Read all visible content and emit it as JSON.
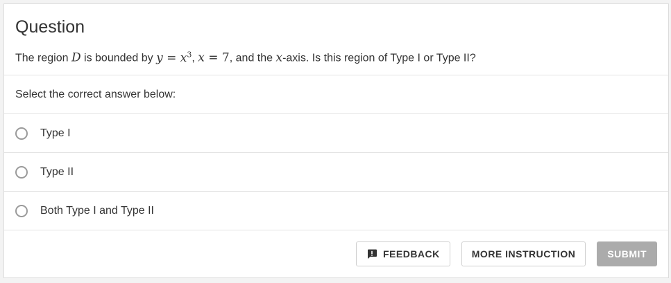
{
  "question": {
    "heading": "Question",
    "text_before_D": "The region ",
    "var_D": "D",
    "text_after_D": " is bounded by ",
    "eq1_lhs": "y",
    "eq1_rhs": "x",
    "eq1_exp": "3",
    "sep1": ", ",
    "eq2_lhs": "x",
    "eq2_rhs": "7",
    "text_after_eq2": ", and the ",
    "var_x": "x",
    "text_end": "-axis. Is this region of Type I or Type II?"
  },
  "prompt": "Select the correct answer below:",
  "options": [
    {
      "label": "Type I",
      "selected": false
    },
    {
      "label": "Type II",
      "selected": false
    },
    {
      "label": "Both Type I and Type II",
      "selected": false
    }
  ],
  "buttons": {
    "feedback": "FEEDBACK",
    "more_instruction": "MORE INSTRUCTION",
    "submit": "SUBMIT"
  },
  "colors": {
    "submit_bg": "#ababab",
    "radio_border": "#9a9a9a",
    "divider": "#e3e3e3"
  }
}
